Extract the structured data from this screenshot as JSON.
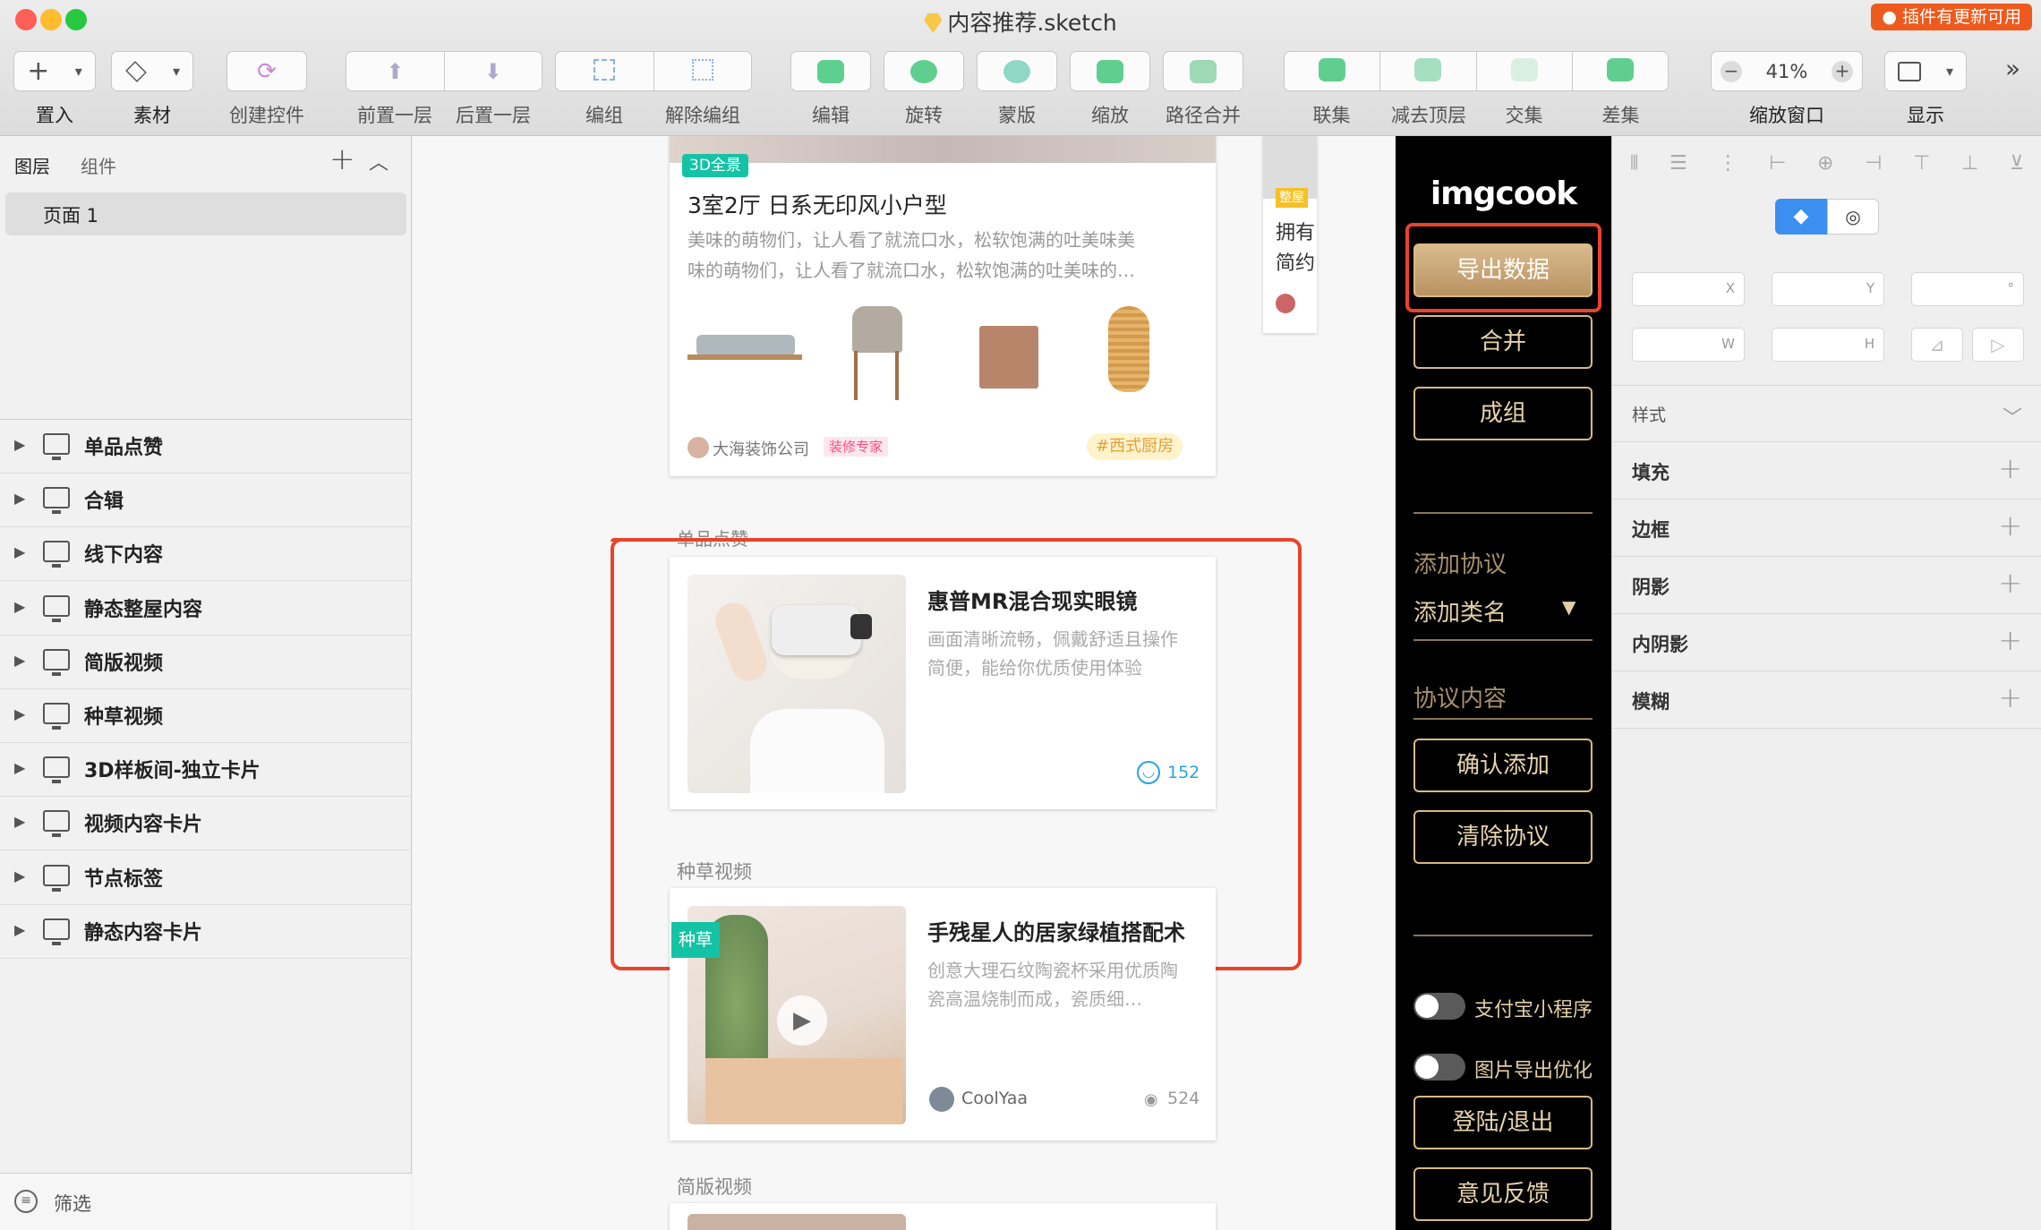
{
  "window": {
    "title": "内容推荐.sketch",
    "update_badge": "● 插件有更新可用"
  },
  "toolbar": {
    "insert": "置入",
    "assets": "素材",
    "create_symbol": "创建控件",
    "forward": "前置一层",
    "backward": "后置一层",
    "group": "编组",
    "ungroup": "解除编组",
    "edit": "编辑",
    "rotate": "旋转",
    "mask": "蒙版",
    "scale": "缩放",
    "flatten": "路径合并",
    "union": "联集",
    "subtract": "减去顶层",
    "intersect": "交集",
    "difference": "差集",
    "zoom_value": "41%",
    "zoom_label": "缩放窗口",
    "view": "显示"
  },
  "sidebar": {
    "tab_layers": "图层",
    "tab_components": "组件",
    "page": "页面 1",
    "artboards": [
      "单品点赞",
      "合辑",
      "线下内容",
      "静态整屋内容",
      "简版视频",
      "种草视频",
      "3D样板间-独立卡片",
      "视频内容卡片",
      "节点标签",
      "静态内容卡片"
    ],
    "filter": "筛选"
  },
  "canvas": {
    "card1": {
      "badge": "3D全景",
      "title": "3室2厅 日系无印风小户型",
      "desc1": "美味的萌物们，让人看了就流口水，松软饱满的吐美味美",
      "desc2": "味的萌物们，让人看了就流口水，松软饱满的吐美味的…",
      "author": "大海装饰公司",
      "author_tag": "装修专家",
      "topic": "#西式厨房"
    },
    "section_like": "单品点赞",
    "card2": {
      "title": "惠普MR混合现实眼镜",
      "desc1": "画面清晰流畅，佩戴舒适且操作",
      "desc2": "简便，能给你优质使用体验",
      "likes": "152"
    },
    "section_grass": "种草视频",
    "card3": {
      "badge": "种草",
      "title": "手残星人的居家绿植搭配术",
      "desc1": "创意大理石纹陶瓷杯采用优质陶",
      "desc2": "瓷高温烧制而成，瓷质细…",
      "author": "CoolYaa",
      "views": "524"
    },
    "section_simple": "简版视频",
    "side_card": {
      "tag": "整屋",
      "line1": "拥有",
      "line2": "简约"
    }
  },
  "plugin": {
    "logo": "imgcook",
    "export": "导出数据",
    "merge": "合并",
    "group": "成组",
    "add_protocol": "添加协议",
    "add_class": "添加类名",
    "protocol_content": "协议内容",
    "confirm_add": "确认添加",
    "clear_protocol": "清除协议",
    "toggle_alipay": "支付宝小程序",
    "toggle_image_opt": "图片导出优化",
    "login": "登陆/退出",
    "feedback": "意见反馈"
  },
  "inspector": {
    "x": "X",
    "y": "Y",
    "deg": "°",
    "w": "W",
    "h": "H",
    "style": "样式",
    "fill": "填充",
    "border": "边框",
    "shadow": "阴影",
    "inner_shadow": "内阴影",
    "blur": "模糊"
  },
  "colors": {
    "highlight": "#e8432b",
    "gold": "#d8b983",
    "teal": "#14c3a5",
    "pink": "#ff4d7e",
    "blue": "#2aa3e0"
  }
}
